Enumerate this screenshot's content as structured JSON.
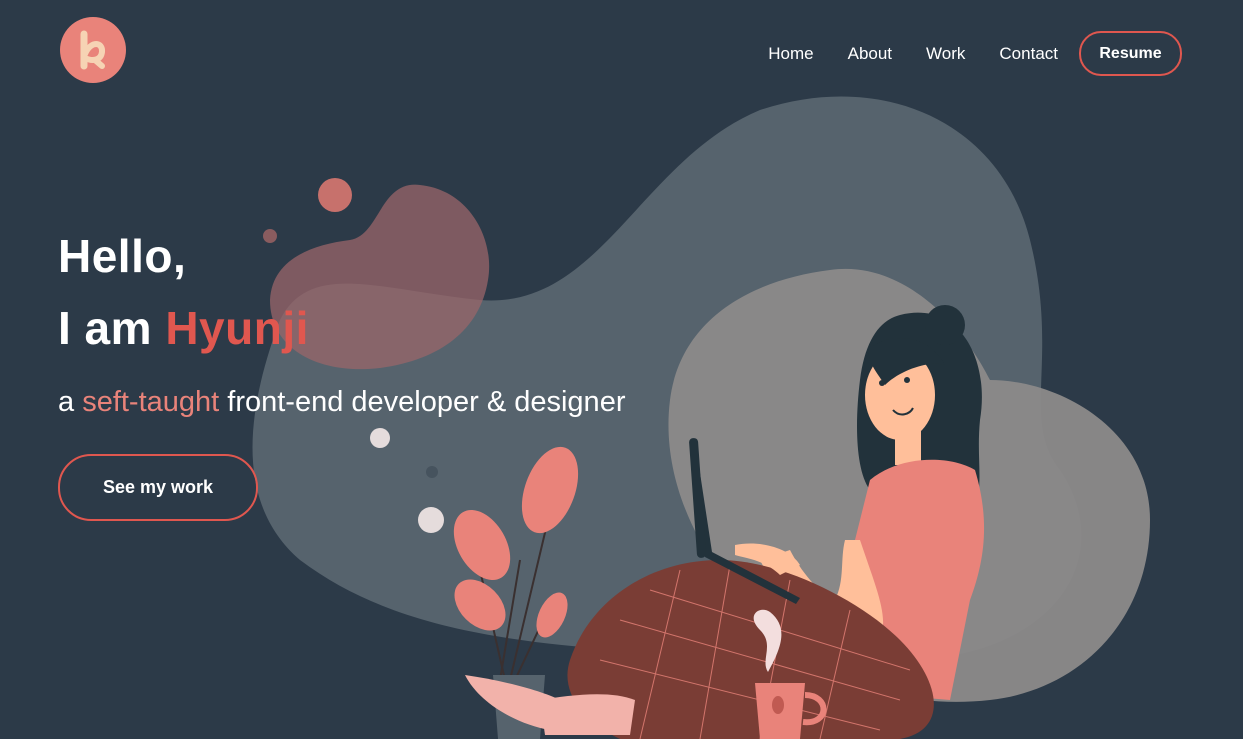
{
  "header": {
    "logo_icon": "letter-k-logo-icon",
    "nav": [
      {
        "label": "Home"
      },
      {
        "label": "About"
      },
      {
        "label": "Work"
      },
      {
        "label": "Contact"
      }
    ],
    "resume_label": "Resume"
  },
  "hero": {
    "greeting": "Hello,",
    "intro_prefix": "I am ",
    "name": "Hyunji",
    "tagline_prefix": "a ",
    "tagline_highlight": "seft-taught",
    "tagline_suffix": " front-end developer & designer",
    "cta_label": "See my work"
  },
  "colors": {
    "background": "#2c3a48",
    "accent": "#e0574f",
    "accent_soft": "#e9837a",
    "text": "#ffffff"
  },
  "illustration": {
    "subject": "woman-with-laptop-illustration",
    "elements": [
      "plant-icon",
      "coffee-mug-icon",
      "laptop-icon"
    ]
  }
}
